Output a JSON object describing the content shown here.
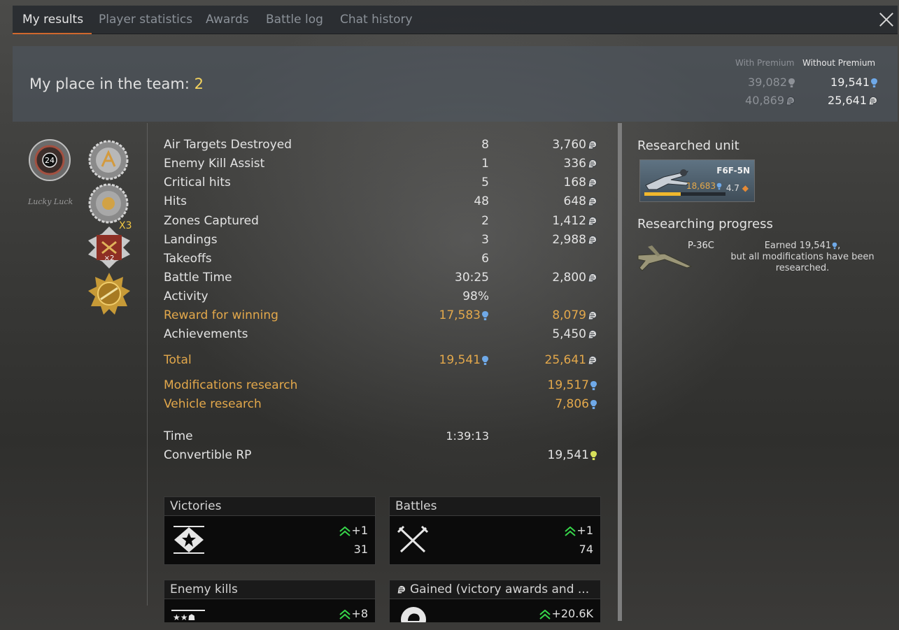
{
  "tabs": [
    {
      "label": "My results",
      "active": true
    },
    {
      "label": "Player statistics",
      "active": false
    },
    {
      "label": "Awards",
      "active": false
    },
    {
      "label": "Battle log",
      "active": false
    },
    {
      "label": "Chat history",
      "active": false
    }
  ],
  "header": {
    "place_label": "My place in the team:",
    "place_value": "2",
    "with_premium_label": "With Premium",
    "without_premium_label": "Without Premium",
    "with_premium_rp": "39,082",
    "with_premium_sl": "40,869",
    "without_premium_rp": "19,541",
    "without_premium_sl": "25,641"
  },
  "badges": {
    "badge_number": "24",
    "signature_text": "Lucky Luck",
    "multiplier_label": "X3",
    "inner_multiplier": "×2"
  },
  "stats": [
    {
      "label": "Air Targets Destroyed",
      "count": "8",
      "sl": "3,760"
    },
    {
      "label": "Enemy Kill Assist",
      "count": "1",
      "sl": "336"
    },
    {
      "label": "Critical hits",
      "count": "5",
      "sl": "168"
    },
    {
      "label": "Hits",
      "count": "48",
      "sl": "648"
    },
    {
      "label": "Zones Captured",
      "count": "2",
      "sl": "1,412"
    },
    {
      "label": "Landings",
      "count": "3",
      "sl": "2,988"
    },
    {
      "label": "Takeoffs",
      "count": "6",
      "sl": ""
    },
    {
      "label": "Battle Time",
      "count": "30:25",
      "sl": "2,800"
    },
    {
      "label": "Activity",
      "count": "98%",
      "sl": ""
    },
    {
      "label": "Reward for winning",
      "count": "17,583",
      "sl": "8,079"
    },
    {
      "label": "Achievements",
      "count": "",
      "sl": "5,450"
    }
  ],
  "total": {
    "label": "Total",
    "rp": "19,541",
    "sl": "25,641"
  },
  "research": [
    {
      "label": "Modifications research",
      "rp": "19,517"
    },
    {
      "label": "Vehicle research",
      "rp": "7,806"
    }
  ],
  "time": {
    "label": "Time",
    "value": "1:39:13"
  },
  "convertible": {
    "label": "Convertible RP",
    "value": "19,541"
  },
  "cards": [
    {
      "title": "Victories",
      "delta": "+1",
      "total": "31"
    },
    {
      "title": "Battles",
      "delta": "+1",
      "total": "74"
    },
    {
      "title": "Enemy kills",
      "delta": "+8",
      "total": ""
    },
    {
      "title": "Gained (victory awards and ...",
      "delta": "+20.6K",
      "total": ""
    }
  ],
  "researched_unit": {
    "title": "Researched unit",
    "name": "F6F-5N",
    "rp": "18,683",
    "br": "4.7",
    "progress": 0.45
  },
  "researching": {
    "title": "Researching progress",
    "name": "P-36C",
    "earned_line": "Earned 19,541",
    "earned_comma": ",",
    "note": "but all modifications have been researched."
  },
  "colors": {
    "accent_orange": "#d0682d",
    "gold_text": "#e3a84b",
    "rp_blue": "#6fa9e8",
    "convertible_yellow": "#d7e05a",
    "up_arrow_green": "#37d64a",
    "place_yellow": "#f4d35e"
  },
  "icons": {
    "rp": "research-point-icon",
    "sl": "silver-lion-icon",
    "close": "close-icon"
  }
}
